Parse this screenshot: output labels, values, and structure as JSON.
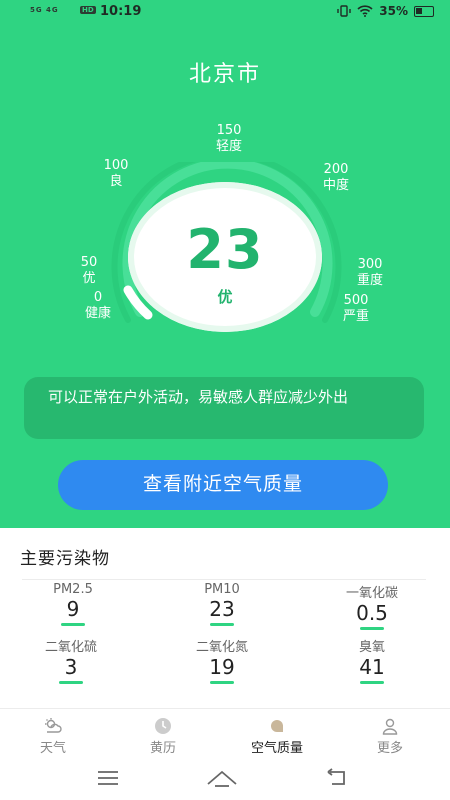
{
  "status_bar": {
    "network": "5G 4G",
    "hd": "HD",
    "time": "10:19",
    "battery": "35%"
  },
  "city": "北京市",
  "gauge": {
    "value": 23,
    "level": "优",
    "scale": [
      {
        "value": "0",
        "label": "健康"
      },
      {
        "value": "50",
        "label": "优"
      },
      {
        "value": "100",
        "label": "良"
      },
      {
        "value": "150",
        "label": "轻度"
      },
      {
        "value": "200",
        "label": "中度"
      },
      {
        "value": "300",
        "label": "重度"
      },
      {
        "value": "500",
        "label": "严重"
      }
    ]
  },
  "advice": "可以正常在户外活动，易敏感人群应减少外出",
  "nearby_button": "查看附近空气质量",
  "pollutants": {
    "title": "主要污染物",
    "items": [
      {
        "name": "PM2.5",
        "value": "9"
      },
      {
        "name": "PM10",
        "value": "23"
      },
      {
        "name": "一氧化碳",
        "value": "0.5"
      },
      {
        "name": "二氧化硫",
        "value": "3"
      },
      {
        "name": "二氧化氮",
        "value": "19"
      },
      {
        "name": "臭氧",
        "value": "41"
      }
    ]
  },
  "tabs": [
    {
      "label": "天气",
      "icon": "weather-icon"
    },
    {
      "label": "黄历",
      "icon": "calendar-icon"
    },
    {
      "label": "空气质量",
      "icon": "air-quality-icon",
      "active": true
    },
    {
      "label": "更多",
      "icon": "profile-icon"
    }
  ],
  "colors": {
    "accent_green": "#2fd482",
    "button_blue": "#2f8af0"
  }
}
